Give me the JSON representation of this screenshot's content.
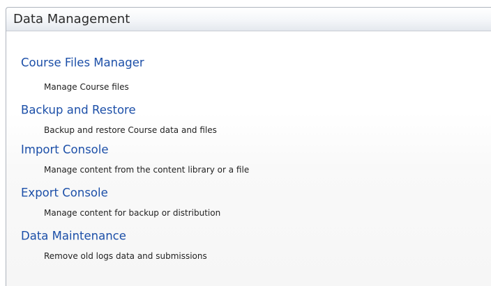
{
  "panel": {
    "title": "Data Management"
  },
  "tools": [
    {
      "label": "Course Files Manager",
      "description": "Manage Course files"
    },
    {
      "label": "Backup and Restore",
      "description": "Backup and restore Course data and files"
    },
    {
      "label": "Import Console",
      "description": "Manage content from the content library or a file"
    },
    {
      "label": "Export Console",
      "description": "Manage content for backup or distribution"
    },
    {
      "label": "Data Maintenance",
      "description": "Remove old logs data and submissions"
    }
  ],
  "colors": {
    "link": "#1c4fa8",
    "header_border": "#aeb4bd",
    "text": "#222222"
  }
}
